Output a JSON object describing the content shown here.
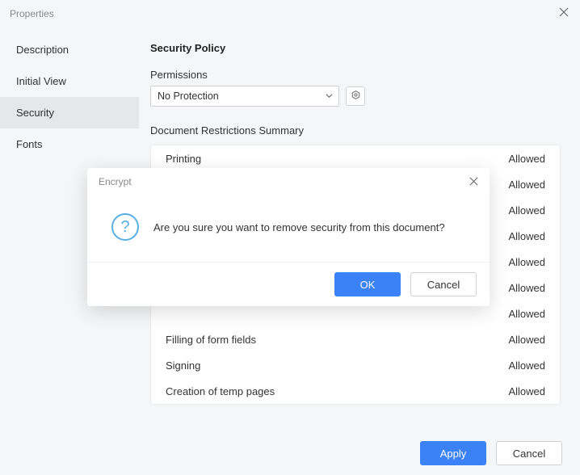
{
  "window": {
    "title": "Properties"
  },
  "sidebar": {
    "items": [
      {
        "label": "Description"
      },
      {
        "label": "Initial View"
      },
      {
        "label": "Security",
        "active": true
      },
      {
        "label": "Fonts"
      }
    ]
  },
  "main": {
    "section_title": "Security Policy",
    "permissions_label": "Permissions",
    "permissions_value": "No Protection",
    "summary_label": "Document Restrictions Summary",
    "rows": [
      {
        "name": "Printing",
        "value": "Allowed"
      },
      {
        "name": "",
        "value": "Allowed"
      },
      {
        "name": "",
        "value": "Allowed"
      },
      {
        "name": "",
        "value": "Allowed"
      },
      {
        "name": "",
        "value": "Allowed"
      },
      {
        "name": "",
        "value": "Allowed"
      },
      {
        "name": "",
        "value": "Allowed"
      },
      {
        "name": "Filling of form fields",
        "value": "Allowed"
      },
      {
        "name": "Signing",
        "value": "Allowed"
      },
      {
        "name": "Creation of temp pages",
        "value": "Allowed"
      }
    ]
  },
  "footer": {
    "apply": "Apply",
    "cancel": "Cancel"
  },
  "modal": {
    "title": "Encrypt",
    "message": "Are you sure you want to remove security from this document?",
    "ok": "OK",
    "cancel": "Cancel"
  }
}
